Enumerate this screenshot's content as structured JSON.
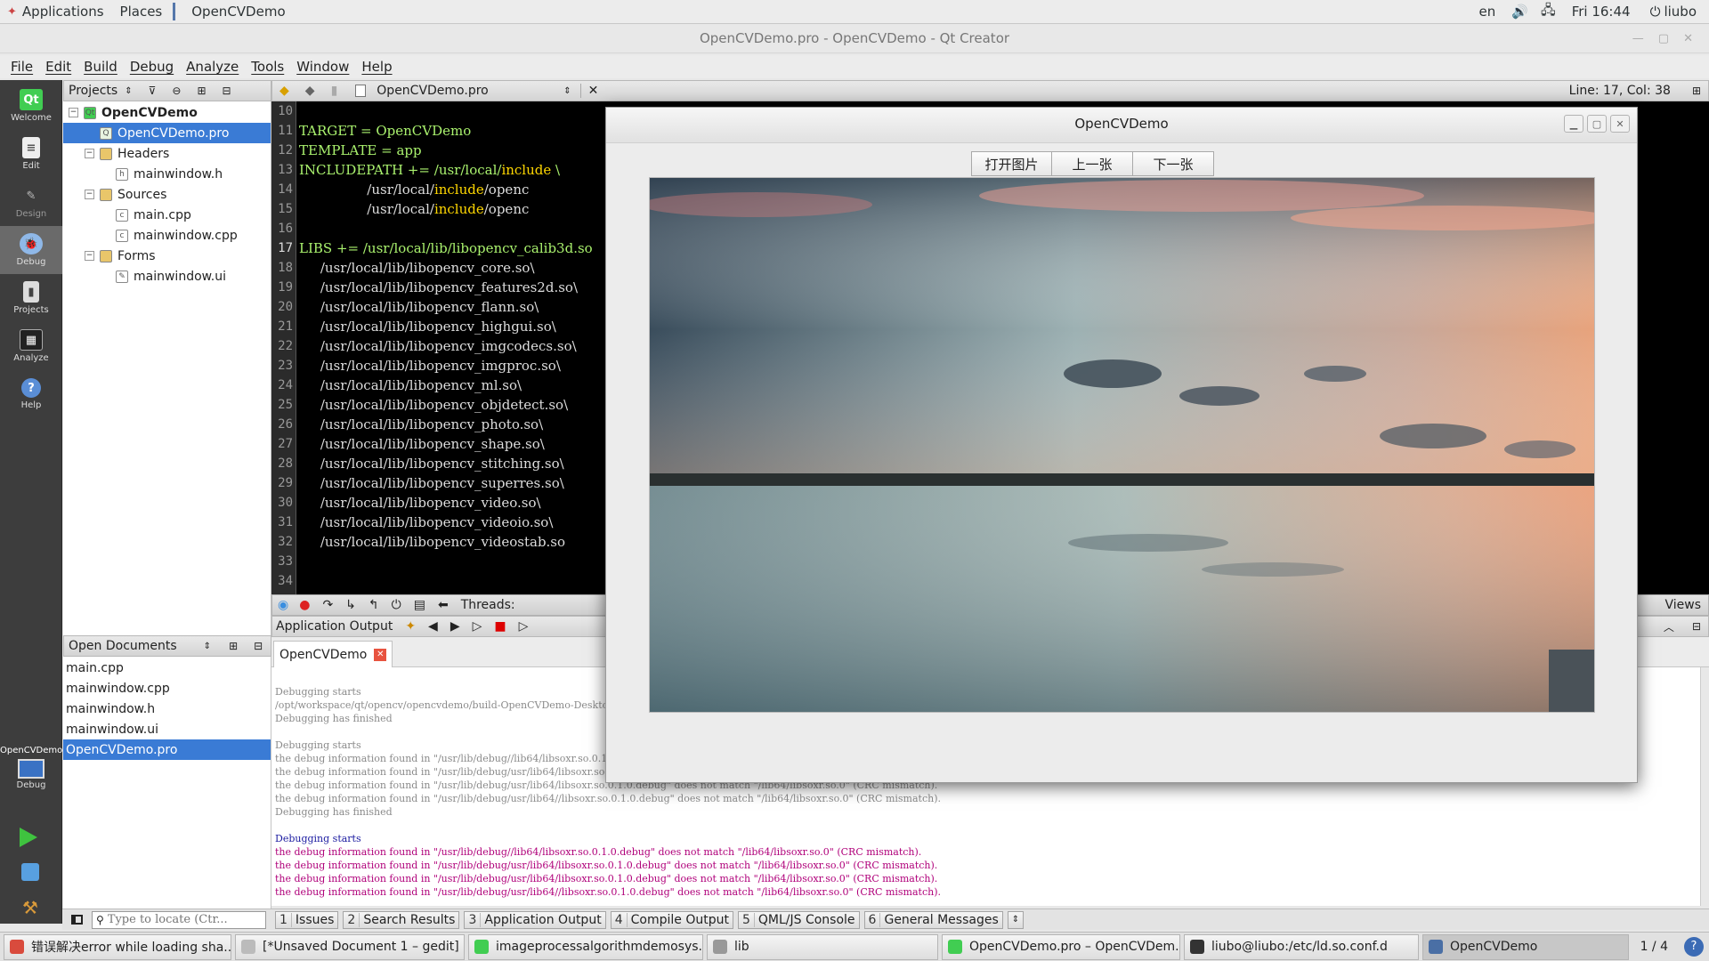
{
  "topbar": {
    "applications": "Applications",
    "places": "Places",
    "window_name": "OpenCVDemo",
    "lang": "en",
    "clock": "Fri 16:44",
    "user": "liubo"
  },
  "window_title": "OpenCVDemo.pro - OpenCVDemo - Qt Creator",
  "menu": [
    "File",
    "Edit",
    "Build",
    "Debug",
    "Analyze",
    "Tools",
    "Window",
    "Help"
  ],
  "modes": [
    "Welcome",
    "Edit",
    "Design",
    "Debug",
    "Projects",
    "Analyze",
    "Help"
  ],
  "kit": {
    "name": "OpenCVDemo",
    "label": "Debug"
  },
  "projects": {
    "title": "Projects",
    "tree": [
      {
        "label": "OpenCVDemo",
        "level": 0,
        "kind": "project"
      },
      {
        "label": "OpenCVDemo.pro",
        "level": 1,
        "kind": "pro",
        "selected": true
      },
      {
        "label": "Headers",
        "level": 1,
        "kind": "folder"
      },
      {
        "label": "mainwindow.h",
        "level": 2,
        "kind": "h"
      },
      {
        "label": "Sources",
        "level": 1,
        "kind": "folder"
      },
      {
        "label": "main.cpp",
        "level": 2,
        "kind": "cpp"
      },
      {
        "label": "mainwindow.cpp",
        "level": 2,
        "kind": "cpp"
      },
      {
        "label": "Forms",
        "level": 1,
        "kind": "folder"
      },
      {
        "label": "mainwindow.ui",
        "level": 2,
        "kind": "ui"
      }
    ]
  },
  "open_documents": {
    "title": "Open Documents",
    "items": [
      "main.cpp",
      "mainwindow.cpp",
      "mainwindow.h",
      "mainwindow.ui",
      "OpenCVDemo.pro"
    ],
    "selected": "OpenCVDemo.pro"
  },
  "editor": {
    "file": "OpenCVDemo.pro",
    "position": "Line: 17, Col: 38",
    "line_numbers": [
      "10",
      "11",
      "12",
      "13",
      "14",
      "15",
      "16",
      "17",
      "18",
      "19",
      "20",
      "21",
      "22",
      "23",
      "24",
      "25",
      "26",
      "27",
      "28",
      "29",
      "30",
      "31",
      "32",
      "33",
      "34"
    ],
    "lines": [
      "",
      "TARGET = OpenCVDemo",
      "TEMPLATE = app",
      "INCLUDEPATH += /usr/local/include \\",
      "                /usr/local/include/openc",
      "                /usr/local/include/openc",
      "",
      "LIBS += /usr/local/lib/libopencv_calib3d.so",
      "     /usr/local/lib/libopencv_core.so\\",
      "     /usr/local/lib/libopencv_features2d.so\\",
      "     /usr/local/lib/libopencv_flann.so\\",
      "     /usr/local/lib/libopencv_highgui.so\\",
      "     /usr/local/lib/libopencv_imgcodecs.so\\",
      "     /usr/local/lib/libopencv_imgproc.so\\",
      "     /usr/local/lib/libopencv_ml.so\\",
      "     /usr/local/lib/libopencv_objdetect.so\\",
      "     /usr/local/lib/libopencv_photo.so\\",
      "     /usr/local/lib/libopencv_shape.so\\",
      "     /usr/local/lib/libopencv_stitching.so\\",
      "     /usr/local/lib/libopencv_superres.so\\",
      "     /usr/local/lib/libopencv_video.so\\",
      "     /usr/local/lib/libopencv_videoio.so\\",
      "     /usr/local/lib/libopencv_videostab.so",
      "",
      ""
    ]
  },
  "debug_toolbar": {
    "threads_label": "Threads:",
    "views_label": "Views"
  },
  "output": {
    "title": "Application Output",
    "tab": "OpenCVDemo",
    "lines": [
      {
        "t": "Debugging starts",
        "c": "gray"
      },
      {
        "t": "/opt/workspace/qt/opencv/opencvdemo/build-OpenCVDemo-Deskto",
        "c": "gray"
      },
      {
        "t": "Debugging has finished",
        "c": "gray"
      },
      {
        "t": "",
        "c": "gray"
      },
      {
        "t": "Debugging starts",
        "c": "gray"
      },
      {
        "t": "the debug information found in \"/usr/lib/debug//lib64/libsoxr.so.0.1.0",
        "c": "gray"
      },
      {
        "t": "the debug information found in \"/usr/lib/debug/usr/lib64/libsoxr.so.0",
        "c": "gray"
      },
      {
        "t": "the debug information found in \"/usr/lib/debug/usr/lib64/libsoxr.so.0.1.0.debug\" does not match \"/lib64/libsoxr.so.0\" (CRC mismatch).",
        "c": "gray"
      },
      {
        "t": "the debug information found in \"/usr/lib/debug/usr/lib64//libsoxr.so.0.1.0.debug\" does not match \"/lib64/libsoxr.so.0\" (CRC mismatch).",
        "c": "gray"
      },
      {
        "t": "Debugging has finished",
        "c": "gray"
      },
      {
        "t": "",
        "c": "gray"
      },
      {
        "t": "Debugging starts",
        "c": "blue"
      },
      {
        "t": "the debug information found in \"/usr/lib/debug//lib64/libsoxr.so.0.1.0.debug\" does not match \"/lib64/libsoxr.so.0\" (CRC mismatch).",
        "c": "mag"
      },
      {
        "t": "the debug information found in \"/usr/lib/debug/usr/lib64/libsoxr.so.0.1.0.debug\" does not match \"/lib64/libsoxr.so.0\" (CRC mismatch).",
        "c": "mag"
      },
      {
        "t": "the debug information found in \"/usr/lib/debug/usr/lib64/libsoxr.so.0.1.0.debug\" does not match \"/lib64/libsoxr.so.0\" (CRC mismatch).",
        "c": "mag"
      },
      {
        "t": "the debug information found in \"/usr/lib/debug/usr/lib64//libsoxr.so.0.1.0.debug\" does not match \"/lib64/libsoxr.so.0\" (CRC mismatch).",
        "c": "mag"
      }
    ]
  },
  "statusbar": {
    "locate_placeholder": "Type to locate (Ctr...",
    "panes": [
      {
        "n": "1",
        "label": "Issues"
      },
      {
        "n": "2",
        "label": "Search Results"
      },
      {
        "n": "3",
        "label": "Application Output"
      },
      {
        "n": "4",
        "label": "Compile Output"
      },
      {
        "n": "5",
        "label": "QML/JS Console"
      },
      {
        "n": "6",
        "label": "General Messages"
      }
    ]
  },
  "app_window": {
    "title": "OpenCVDemo",
    "buttons": [
      "打开图片",
      "上一张",
      "下一张"
    ]
  },
  "taskbar": {
    "tasks": [
      {
        "label": "错误解决error while loading sha...",
        "color": "#d94b3d"
      },
      {
        "label": "[*Unsaved Document 1 – gedit]",
        "color": "#bbbbbb"
      },
      {
        "label": "imageprocessalgorithmdemosys...",
        "color": "#41cd52"
      },
      {
        "label": "lib",
        "color": "#999999"
      },
      {
        "label": "OpenCVDemo.pro – OpenCVDem...",
        "color": "#41cd52"
      },
      {
        "label": "liubo@liubo:/etc/ld.so.conf.d",
        "color": "#333333"
      },
      {
        "label": "OpenCVDemo",
        "color": "#4a6fa5"
      }
    ],
    "pager": "1 / 4"
  }
}
